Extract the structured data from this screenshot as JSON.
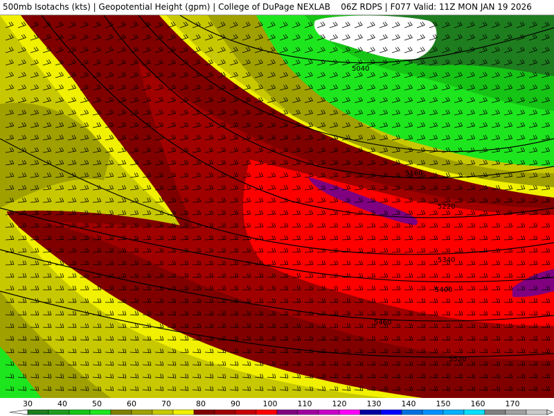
{
  "header": {
    "title": "500mb Isotachs (kts) | Geopotential Height (gpm) | College of DuPage NEXLAB    06Z RDPS | F077 Valid: 11Z MON JAN 19 2026"
  },
  "map": {
    "contour_labels": [
      "5040",
      "5160",
      "5220",
      "5340",
      "5400",
      "5460",
      "5520"
    ]
  },
  "colorbar": {
    "tick_labels": [
      "30",
      "40",
      "50",
      "60",
      "70",
      "80",
      "90",
      "100",
      "110",
      "120",
      "130",
      "140",
      "150",
      "160",
      "170"
    ],
    "colors": [
      "#1e7d1e",
      "#1e9a1e",
      "#16c416",
      "#1ee61e",
      "#808000",
      "#a0a000",
      "#c8c800",
      "#f0f000",
      "#800000",
      "#a00000",
      "#c80000",
      "#ff0000",
      "#800080",
      "#a000a0",
      "#c800c8",
      "#ff00ff",
      "#0000a0",
      "#0000ff",
      "#0070e0",
      "#0090ff",
      "#00b0ff",
      "#00e0ff",
      "#808080",
      "#a0a0a0",
      "#c8c8c8"
    ]
  }
}
